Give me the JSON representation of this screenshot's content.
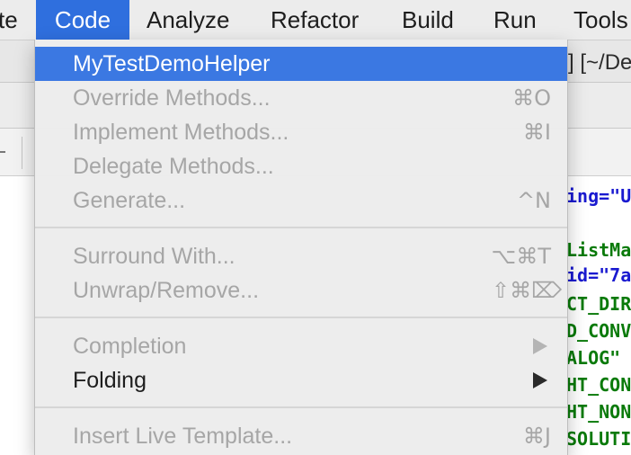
{
  "menubar": {
    "items": [
      {
        "label": "te"
      },
      {
        "label": "Code"
      },
      {
        "label": "Analyze"
      },
      {
        "label": "Refactor"
      },
      {
        "label": "Build"
      },
      {
        "label": "Run"
      },
      {
        "label": "Tools"
      }
    ]
  },
  "background": {
    "path_text": "] [~/De",
    "code_lines": [
      {
        "text": "ing=\"U"
      },
      {
        "text": "ListMa"
      },
      {
        "text": "id=\"7a"
      },
      {
        "text": "CT_DIR"
      },
      {
        "text": "D_CONV"
      },
      {
        "text": "ALOG\""
      },
      {
        "text": "HT_CON"
      },
      {
        "text": "HT_NON"
      },
      {
        "text": "SOLUTI"
      }
    ]
  },
  "code_menu": {
    "items": [
      {
        "label": "MyTestDemoHelper",
        "shortcut": "",
        "state": "highlighted"
      },
      {
        "label": "Override Methods...",
        "shortcut": "⌘O",
        "state": "disabled"
      },
      {
        "label": "Implement Methods...",
        "shortcut": "⌘I",
        "state": "disabled"
      },
      {
        "label": "Delegate Methods...",
        "shortcut": "",
        "state": "disabled"
      },
      {
        "label": "Generate...",
        "shortcut": "^N",
        "state": "disabled"
      },
      {
        "label": "Surround With...",
        "shortcut": "⌥⌘T",
        "state": "disabled"
      },
      {
        "label": "Unwrap/Remove...",
        "shortcut": "⇧⌘⌦",
        "state": "disabled"
      },
      {
        "label": "Completion",
        "shortcut": "",
        "state": "disabled",
        "submenu": true
      },
      {
        "label": "Folding",
        "shortcut": "",
        "state": "enabled",
        "submenu": true
      },
      {
        "label": "Insert Live Template...",
        "shortcut": "⌘J",
        "state": "disabled"
      }
    ]
  },
  "colors": {
    "accent": "#2f6fde",
    "highlight": "#3b78e2",
    "disabled_text": "#a6a6a6",
    "code_keyword": "#1a1ad0",
    "code_string": "#0a7a0a"
  }
}
